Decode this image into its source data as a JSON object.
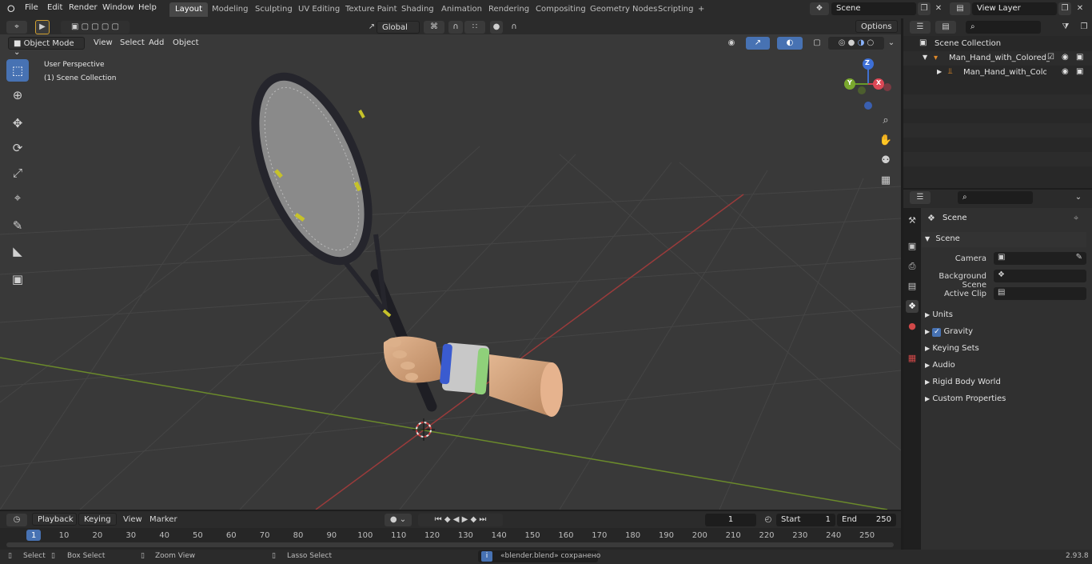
{
  "topbar": {
    "menus": [
      "File",
      "Edit",
      "Render",
      "Window",
      "Help"
    ],
    "workspaces": [
      "Layout",
      "Modeling",
      "Sculpting",
      "UV Editing",
      "Texture Paint",
      "Shading",
      "Animation",
      "Rendering",
      "Compositing",
      "Geometry Nodes",
      "Scripting"
    ],
    "active_workspace": "Layout",
    "add_tab": "+",
    "scene_name": "Scene",
    "view_layer": "View Layer"
  },
  "viewport_header": {
    "mode": "Object Mode",
    "menus": [
      "View",
      "Select",
      "Add",
      "Object"
    ],
    "transform": "Global",
    "options": "Options"
  },
  "viewport": {
    "overlay_line1": "User Perspective",
    "overlay_line2": "(1) Scene Collection",
    "axis_z": "Z",
    "axis_y": "Y",
    "axis_x": "X",
    "colors": {
      "x_axis_line": "#9a3b3b",
      "y_axis_line": "#6b8a2b",
      "grid_bg": "#393939",
      "active_tool": "#4772b3"
    }
  },
  "outliner": {
    "root": "Scene Collection",
    "items": [
      {
        "label": "Man_Hand_with_Colored_Wris"
      },
      {
        "label": "Man_Hand_with_Colored"
      }
    ]
  },
  "properties": {
    "header": "Scene",
    "section": "Scene",
    "fields": [
      {
        "label": "Camera"
      },
      {
        "label": "Background Scene"
      },
      {
        "label": "Active Clip"
      }
    ],
    "panels": [
      "Units",
      "Gravity",
      "Keying Sets",
      "Audio",
      "Rigid Body World",
      "Custom Properties"
    ]
  },
  "timeline": {
    "menus": [
      "Playback",
      "Keying",
      "View",
      "Marker"
    ],
    "current_frame": "1",
    "start_label": "Start",
    "start": "1",
    "end_label": "End",
    "end": "250",
    "ticks": [
      "1",
      "10",
      "20",
      "30",
      "40",
      "50",
      "60",
      "70",
      "80",
      "90",
      "100",
      "110",
      "120",
      "130",
      "140",
      "150",
      "160",
      "170",
      "180",
      "190",
      "200",
      "210",
      "220",
      "230",
      "240",
      "250"
    ]
  },
  "statusbar": {
    "select": "Select",
    "box_select": "Box Select",
    "zoom_view": "Zoom View",
    "lasso_select": "Lasso Select",
    "message": "«blender.blend» сохранено",
    "version": "2.93.8"
  }
}
